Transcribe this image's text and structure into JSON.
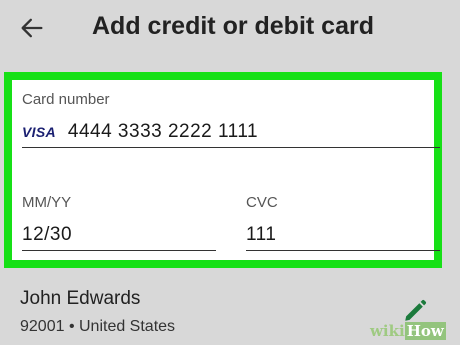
{
  "header": {
    "title": "Add credit or debit card",
    "back_icon": "arrow-left-icon"
  },
  "card_form": {
    "card_number_label": "Card number",
    "card_brand": "VISA",
    "card_number_value": "4444 3333 2222 1111",
    "expiry_label": "MM/YY",
    "expiry_value": "12/30",
    "cvc_label": "CVC",
    "cvc_value": "111",
    "highlight_color": "#16e016"
  },
  "billing": {
    "name": "John Edwards",
    "address": "92001 • United States",
    "edit_icon": "pencil-icon",
    "edit_icon_color": "#1b7a3c"
  },
  "watermark": {
    "part1": "wiki",
    "part2": "How"
  }
}
